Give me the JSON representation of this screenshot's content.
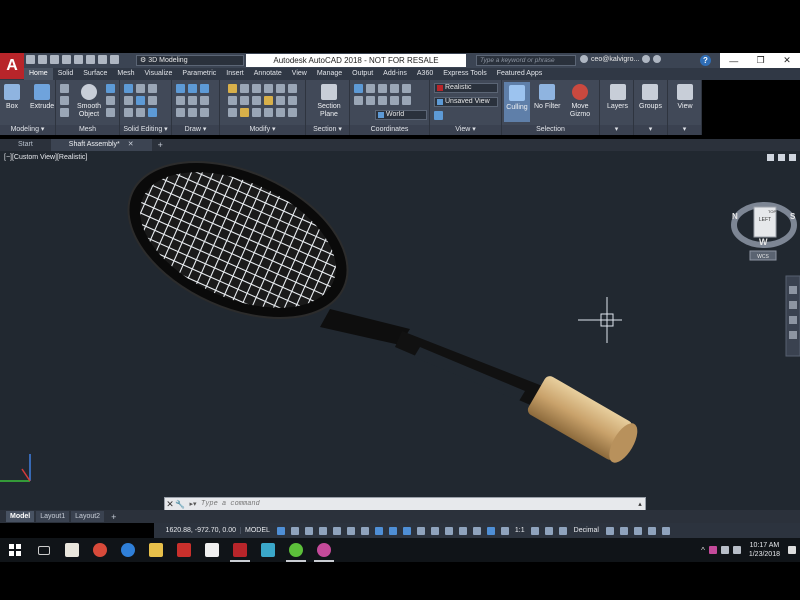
{
  "window": {
    "title": "Autodesk AutoCAD 2018 - NOT FOR RESALE",
    "app_logo": "A",
    "workspace": "3D Modeling",
    "search_placeholder": "Type a keyword or phrase",
    "user": "ceo@kalvigro...",
    "help": "?",
    "controls": {
      "minimize": "—",
      "restore": "❐",
      "close": "✕"
    }
  },
  "ribbon_tabs": [
    "Home",
    "Solid",
    "Surface",
    "Mesh",
    "Visualize",
    "Parametric",
    "Insert",
    "Annotate",
    "View",
    "Manage",
    "Output",
    "Add-ins",
    "A360",
    "Express Tools",
    "Featured Apps"
  ],
  "ribbon": {
    "modeling": {
      "label": "Modeling ▾",
      "box": "Box",
      "extrude": "Extrude"
    },
    "mesh": {
      "label": "Mesh",
      "smooth_object": "Smooth Object"
    },
    "solid_editing": {
      "label": "Solid Editing ▾"
    },
    "draw": {
      "label": "Draw ▾"
    },
    "modify": {
      "label": "Modify ▾"
    },
    "section": {
      "label": "Section ▾",
      "section_plane": "Section Plane"
    },
    "coordinates": {
      "label": "Coordinates",
      "world": "World"
    },
    "view": {
      "label": "View ▾",
      "visual_style": "Realistic",
      "named_view": "Unsaved View"
    },
    "selection": {
      "label": "Selection",
      "culling": "Culling",
      "no_filter": "No Filter",
      "move_gizmo": "Move Gizmo"
    },
    "layers": "Layers",
    "groups": "Groups",
    "view_big": "View"
  },
  "doc_tabs": {
    "start": "Start",
    "active": "Shaft Assembly*",
    "close": "✕",
    "add": "+"
  },
  "viewport": {
    "label": "[−][Custom View][Realistic]",
    "viewcube": {
      "face": "LEFT",
      "top": "TOP",
      "n": "N",
      "s": "S",
      "w": "W",
      "wcs": "WCS"
    }
  },
  "command_line": {
    "placeholder": "Type a command",
    "close": "✕",
    "settings": "🔧"
  },
  "layout_tabs": [
    "Model",
    "Layout1",
    "Layout2"
  ],
  "status_bar": {
    "coordinates": "1620.88, -972.70, 0.00",
    "model": "MODEL",
    "scale": "1:1",
    "units": "Decimal"
  },
  "taskbar": {
    "time": "10:17 AM",
    "date": "1/23/2018"
  },
  "colors": {
    "autocad_red": "#b8252a",
    "ribbon_bg": "#414958",
    "viewport_bg": "#212830",
    "racket_frame": "#0e0e0e",
    "racket_grip": "#c9a26b"
  }
}
